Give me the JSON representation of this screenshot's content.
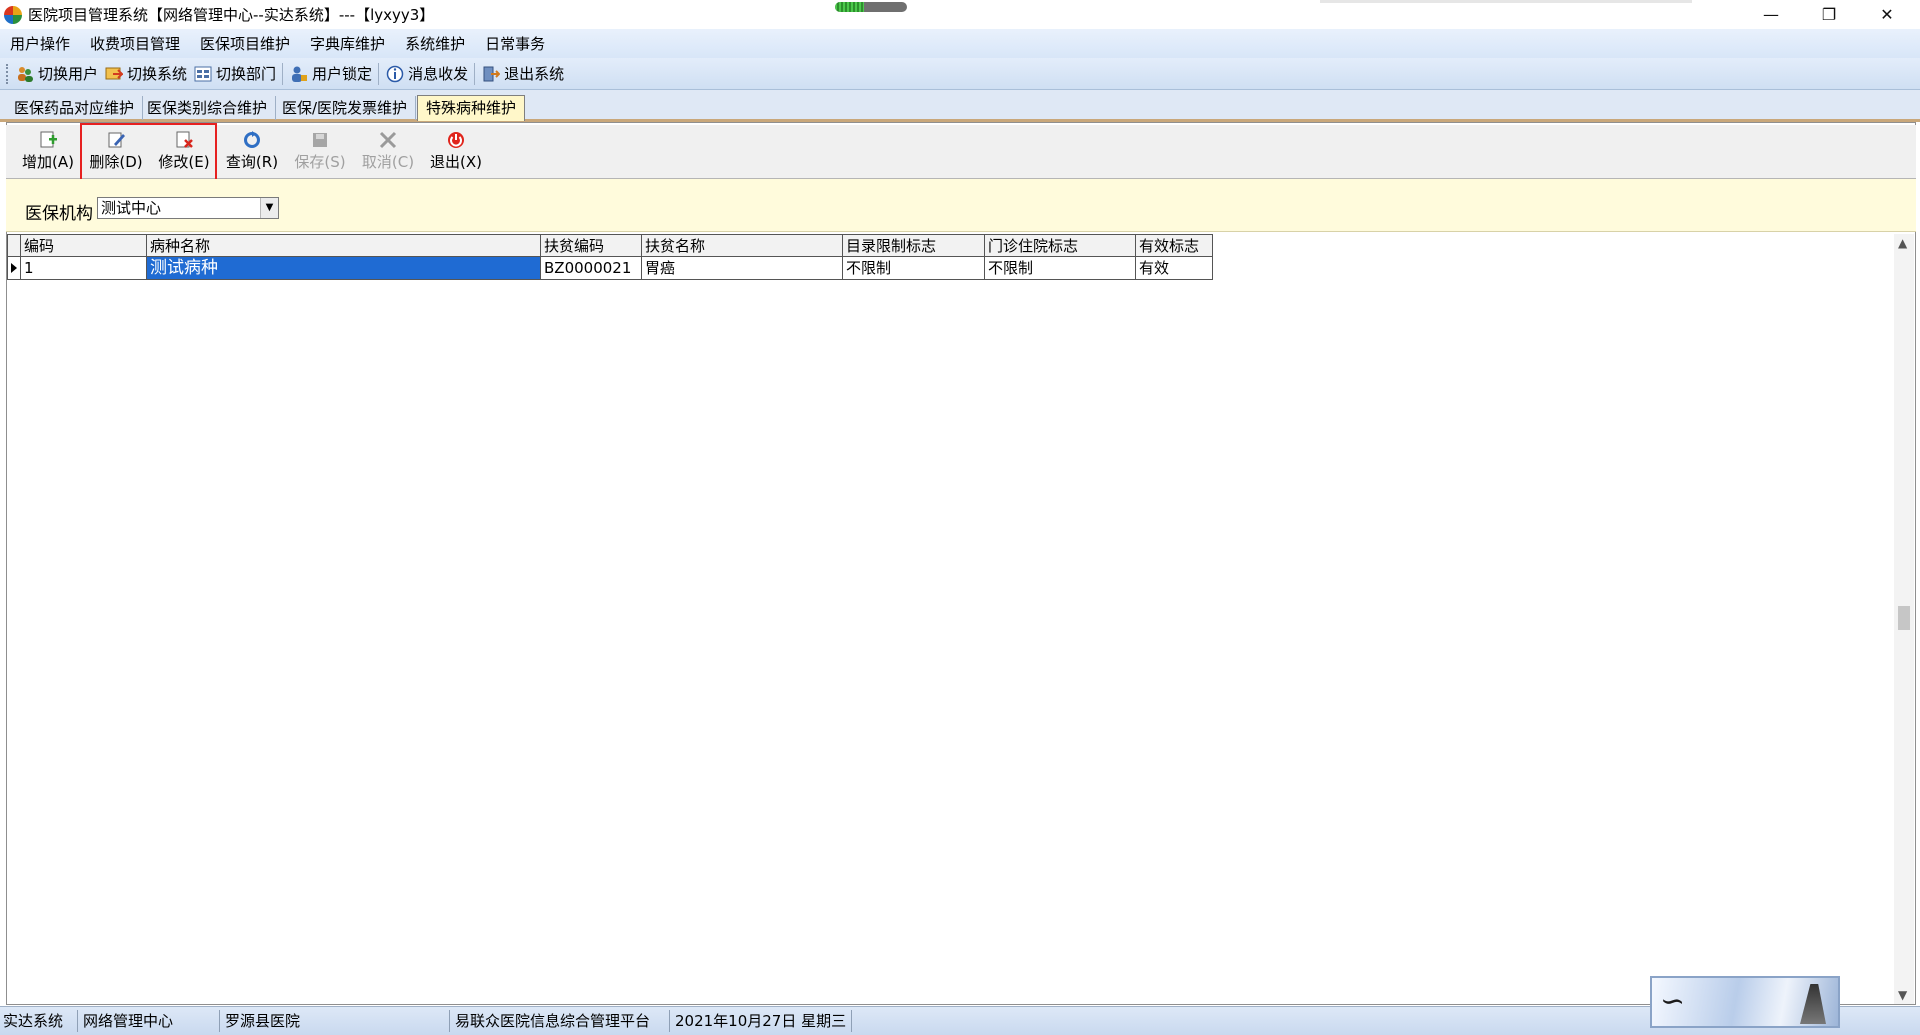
{
  "window": {
    "title": "医院项目管理系统【网络管理中心--实达系统】---【lyxyy3】",
    "progress_fraction": 0.4
  },
  "menu": {
    "items": [
      "用户操作",
      "收费项目管理",
      "医保项目维护",
      "字典库维护",
      "系统维护",
      "日常事务"
    ]
  },
  "toolbar": {
    "switch_user": "切换用户",
    "switch_system": "切换系统",
    "switch_dept": "切换部门",
    "user_lock": "用户锁定",
    "messages": "消息收发",
    "exit_system": "退出系统"
  },
  "tabs": {
    "items": [
      "医保药品对应维护",
      "医保类别综合维护",
      "医保/医院发票维护",
      "特殊病种维护"
    ],
    "active_index": 3
  },
  "actions": {
    "add": "增加(A)",
    "delete": "删除(D)",
    "edit": "修改(E)",
    "query": "查询(R)",
    "save": "保存(S)",
    "cancel": "取消(C)",
    "exit": "退出(X)"
  },
  "filter": {
    "label": "医保机构",
    "selected": "测试中心"
  },
  "grid": {
    "columns": [
      "编码",
      "病种名称",
      "扶贫编码",
      "扶贫名称",
      "目录限制标志",
      "门诊住院标志",
      "有效标志"
    ],
    "rows": [
      [
        "1",
        "测试病种",
        "BZ0000021",
        "胃癌",
        "不限制",
        "不限制",
        "有效"
      ]
    ]
  },
  "status": {
    "system": "实达系统",
    "center": "网络管理中心",
    "hospital": "罗源县医院",
    "platform": "易联众医院信息综合管理平台",
    "date": "2021年10月27日  星期三"
  },
  "colors": {
    "selection": "#1f6bd3",
    "highlight_box": "#e62020",
    "active_tab": "#fff7c9",
    "filter_bg": "#fffbdc"
  }
}
